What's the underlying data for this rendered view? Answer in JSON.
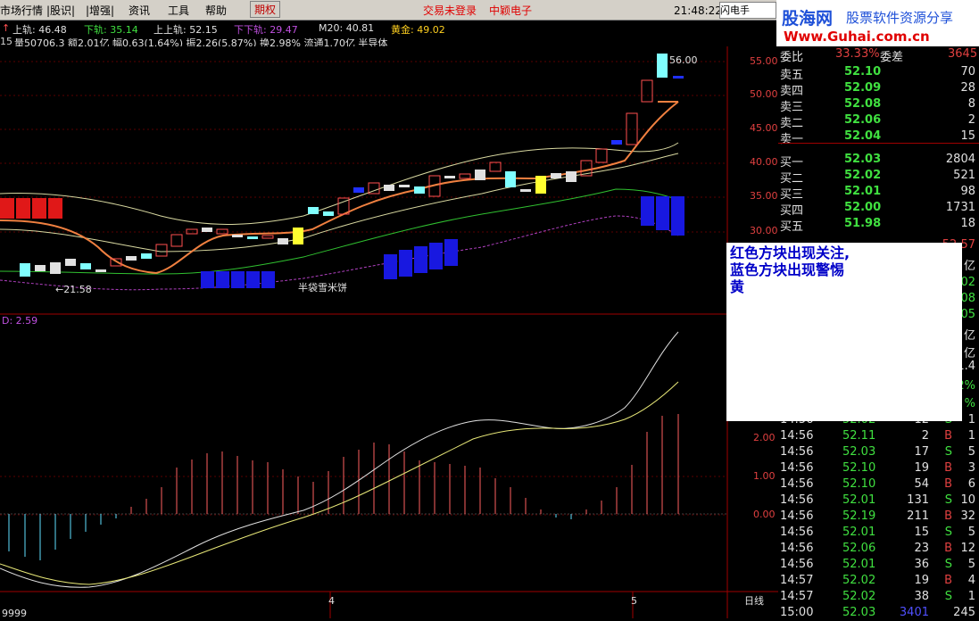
{
  "menu": {
    "items": [
      "市场行情",
      "|股识|",
      "|增强|",
      "资讯",
      "工具",
      "帮助"
    ],
    "options_label": "期权",
    "status": "交易未登录",
    "stock_name": "中颖电子",
    "clock": "21:48:22 周六",
    "tab": "闪电手"
  },
  "logo": {
    "site_name": "股海网",
    "slogan": "股票软件资源分享",
    "url": "Www.Guhai.com.cn"
  },
  "info": {
    "upper": "上轨: 46.48",
    "lower": "下轨: 35.14",
    "upper2": "上上轨: 52.15",
    "lower2": "下下轨: 29.47",
    "m20": "M20: 40.81",
    "gold": "黄金: 49.02",
    "line2": "量50706.3 额2.01亿 幅0.63(1.64%) 振2.26(5.87%) 换2.98% 流通1.70亿 半导体",
    "prefix": "15"
  },
  "chart_labels": {
    "high_price": "56.00",
    "low_price": "←21.58",
    "annotation": "半袋雪米饼",
    "macd": "D: 2.59",
    "bottom_left": "9999",
    "x_ticks": [
      "4",
      "5"
    ],
    "period": "日线"
  },
  "axis": {
    "price": [
      "55.00",
      "50.00",
      "45.00",
      "40.00",
      "35.00",
      "30.00"
    ],
    "macd": [
      "2.00",
      "1.00",
      "0.00"
    ]
  },
  "orderbook": {
    "top_label_left": "委比",
    "top_value": "33.33%",
    "top_label_right": "委差",
    "top_right_value": "3645",
    "asks": [
      {
        "label": "卖五",
        "price": "52.10",
        "vol": "70"
      },
      {
        "label": "卖四",
        "price": "52.09",
        "vol": "28"
      },
      {
        "label": "卖三",
        "price": "52.08",
        "vol": "8"
      },
      {
        "label": "卖二",
        "price": "52.06",
        "vol": "2"
      },
      {
        "label": "卖一",
        "price": "52.04",
        "vol": "15"
      }
    ],
    "bids": [
      {
        "label": "买一",
        "price": "52.03",
        "vol": "2804"
      },
      {
        "label": "买二",
        "price": "52.02",
        "vol": "521"
      },
      {
        "label": "买三",
        "price": "52.01",
        "vol": "98"
      },
      {
        "label": "买四",
        "price": "52.00",
        "vol": "1731"
      },
      {
        "label": "买五",
        "price": "51.98",
        "vol": "18"
      }
    ]
  },
  "side_values": [
    "52.57",
    "亿",
    "02",
    "08",
    "05",
    "亿",
    "亿",
    "1.4",
    "2%",
    "%"
  ],
  "trades": [
    {
      "time": "14:56",
      "price": "52.02",
      "vol": "12",
      "side": "S",
      "n": "1"
    },
    {
      "time": "14:56",
      "price": "52.11",
      "vol": "2",
      "side": "B",
      "n": "1"
    },
    {
      "time": "14:56",
      "price": "52.03",
      "vol": "17",
      "side": "S",
      "n": "5"
    },
    {
      "time": "14:56",
      "price": "52.10",
      "vol": "19",
      "side": "B",
      "n": "3"
    },
    {
      "time": "14:56",
      "price": "52.10",
      "vol": "54",
      "side": "B",
      "n": "6"
    },
    {
      "time": "14:56",
      "price": "52.01",
      "vol": "131",
      "side": "S",
      "n": "10"
    },
    {
      "time": "14:56",
      "price": "52.19",
      "vol": "211",
      "side": "B",
      "n": "32"
    },
    {
      "time": "14:56",
      "price": "52.01",
      "vol": "15",
      "side": "S",
      "n": "5"
    },
    {
      "time": "14:56",
      "price": "52.06",
      "vol": "23",
      "side": "B",
      "n": "12"
    },
    {
      "time": "14:56",
      "price": "52.01",
      "vol": "36",
      "side": "S",
      "n": "5"
    },
    {
      "time": "14:57",
      "price": "52.02",
      "vol": "19",
      "side": "B",
      "n": "4"
    },
    {
      "time": "14:57",
      "price": "52.02",
      "vol": "38",
      "side": "S",
      "n": "1"
    },
    {
      "time": "15:00",
      "price": "52.03",
      "vol": "3401",
      "side": "",
      "n": "245"
    }
  ],
  "popup": {
    "line1": "红色方块出现关注,",
    "line2": "蓝色方块出现警惕",
    "line3": "黄"
  }
}
